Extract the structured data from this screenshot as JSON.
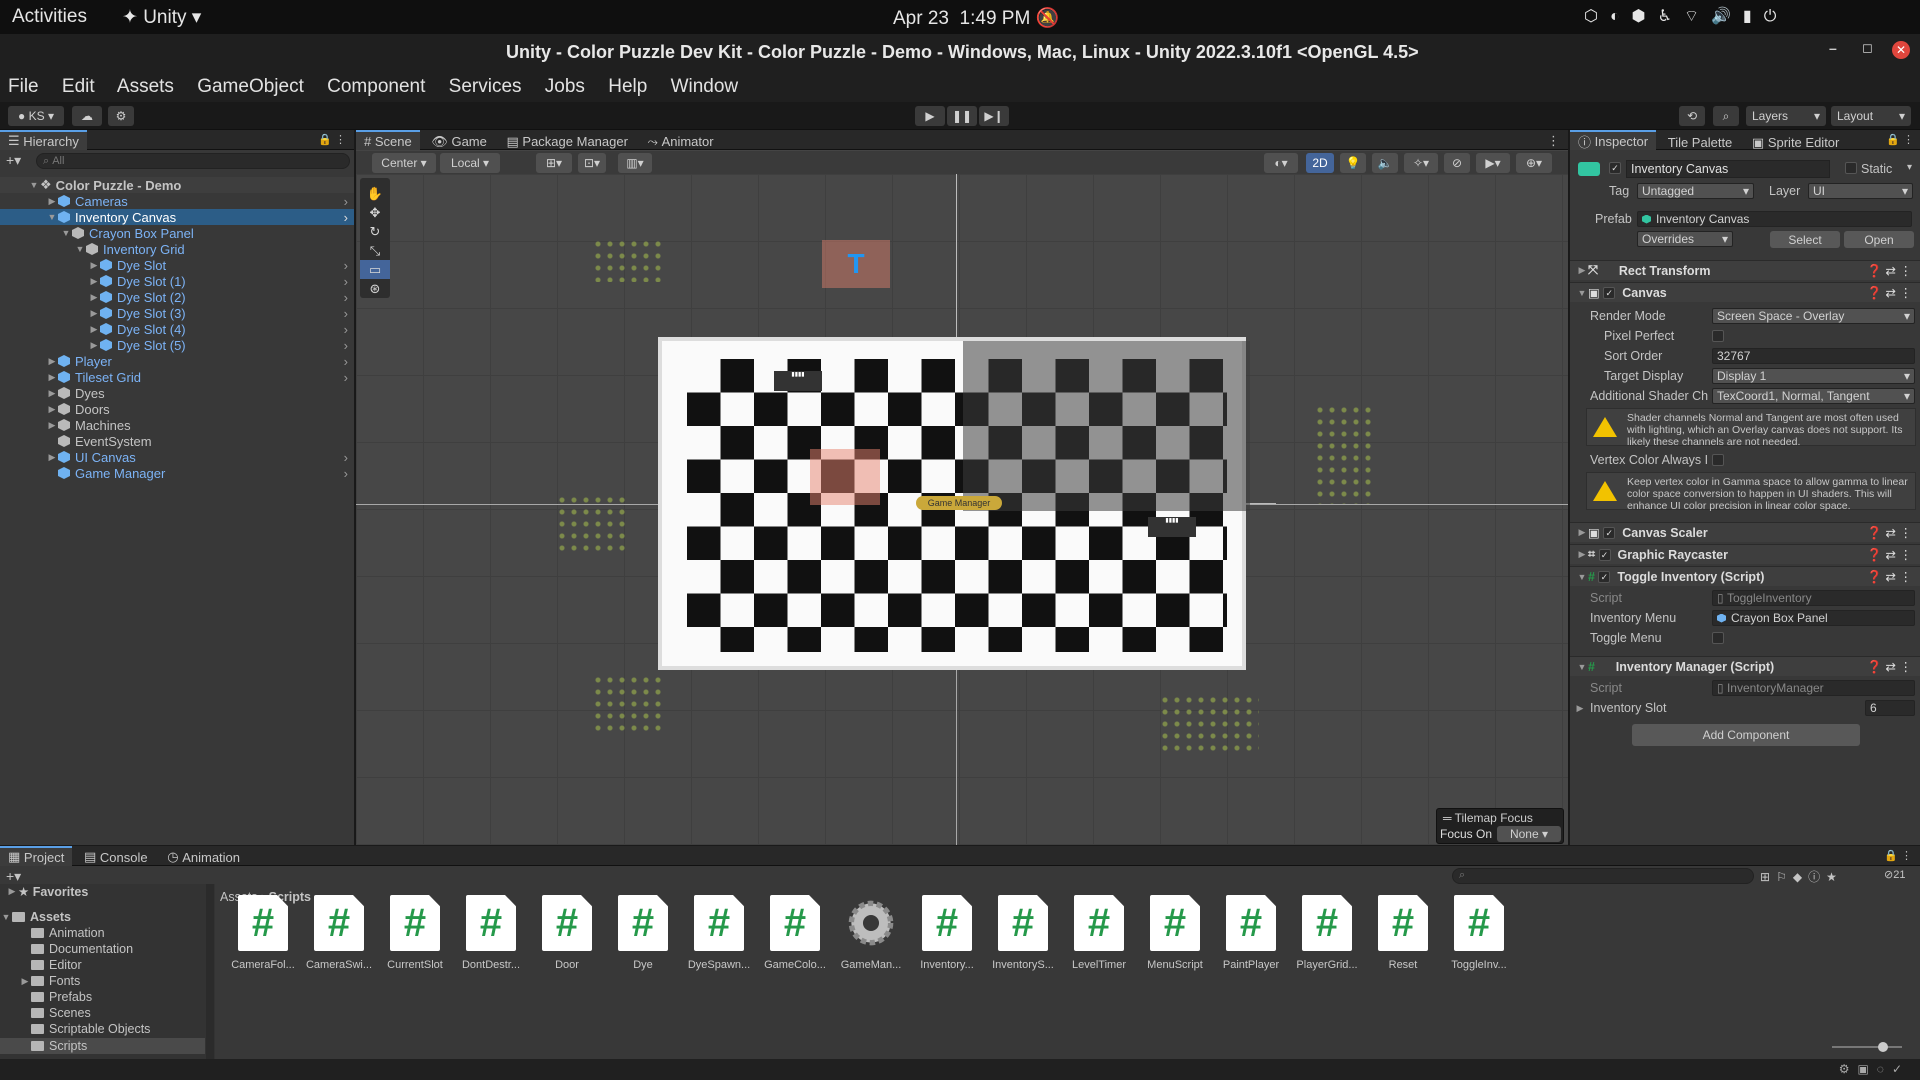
{
  "system": {
    "activities": "Activities",
    "app_menu": "Unity",
    "date": "Apr 23",
    "time": "1:49 PM"
  },
  "window": {
    "title": "Unity - Color Puzzle Dev Kit - Color Puzzle - Demo - Windows, Mac, Linux - Unity 2022.3.10f1 <OpenGL 4.5>"
  },
  "menu": [
    "File",
    "Edit",
    "Assets",
    "GameObject",
    "Component",
    "Services",
    "Jobs",
    "Help",
    "Window"
  ],
  "toolbar": {
    "account": "KS",
    "layers": "Layers",
    "layout": "Layout"
  },
  "hierarchy": {
    "tab": "Hierarchy",
    "search_placeholder": "All",
    "scene": "Color Puzzle - Demo",
    "items": [
      "Cameras",
      "Inventory Canvas",
      "Crayon Box Panel",
      "Inventory Grid",
      "Dye Slot",
      "Dye Slot (1)",
      "Dye Slot (2)",
      "Dye Slot (3)",
      "Dye Slot (4)",
      "Dye Slot (5)",
      "Player",
      "Tileset Grid",
      "Dyes",
      "Doors",
      "Machines",
      "EventSystem",
      "UI Canvas",
      "Game Manager"
    ]
  },
  "scene_tabs": [
    "Scene",
    "Game",
    "Package Manager",
    "Animator"
  ],
  "scene_toolbar": {
    "pivot": "Center",
    "space": "Local",
    "mode_2d": "2D"
  },
  "scene_overlay": {
    "game_manager_label": "Game Manager",
    "tilemap_focus": "Tilemap Focus",
    "focus_on_label": "Focus On",
    "focus_on_value": "None"
  },
  "inspector_tabs": [
    "Inspector",
    "Tile Palette",
    "Sprite Editor"
  ],
  "inspector": {
    "object_name": "Inventory Canvas",
    "static_label": "Static",
    "tag_label": "Tag",
    "tag_value": "Untagged",
    "layer_label": "Layer",
    "layer_value": "UI",
    "prefab_label": "Prefab",
    "prefab_value": "Inventory Canvas",
    "overrides": "Overrides",
    "select": "Select",
    "open": "Open",
    "components": {
      "rect_transform": "Rect Transform",
      "canvas": "Canvas",
      "canvas_scaler": "Canvas Scaler",
      "graphic_raycaster": "Graphic Raycaster",
      "toggle_inventory": "Toggle Inventory (Script)",
      "inventory_manager": "Inventory Manager (Script)"
    },
    "canvas": {
      "render_mode_label": "Render Mode",
      "render_mode": "Screen Space - Overlay",
      "pixel_perfect_label": "Pixel Perfect",
      "sort_order_label": "Sort Order",
      "sort_order": "32767",
      "target_display_label": "Target Display",
      "target_display": "Display 1",
      "shader_label": "Additional Shader Ch",
      "shader_value": "TexCoord1, Normal, Tangent",
      "warning1": "Shader channels Normal and Tangent are most often used with lighting, which an Overlay canvas does not support. Its likely these channels are not needed.",
      "vertex_label": "Vertex Color Always I",
      "warning2": "Keep vertex color in Gamma space to allow gamma to linear color space conversion to happen in UI shaders. This will enhance UI color precision in linear color space."
    },
    "toggle_inventory": {
      "script_label": "Script",
      "script_value": "ToggleInventory",
      "menu_label": "Inventory Menu",
      "menu_value": "Crayon Box Panel",
      "toggle_label": "Toggle Menu"
    },
    "inventory_manager": {
      "script_label": "Script",
      "script_value": "InventoryManager",
      "slot_label": "Inventory Slot",
      "slot_value": "6"
    },
    "add_component": "Add Component"
  },
  "project": {
    "tabs": [
      "Project",
      "Console",
      "Animation"
    ],
    "favorites": "Favorites",
    "assets": "Assets",
    "folders": [
      "Animation",
      "Documentation",
      "Editor",
      "Fonts",
      "Prefabs",
      "Scenes",
      "Scriptable Objects",
      "Scripts"
    ],
    "breadcrumb_root": "Assets",
    "breadcrumb_leaf": "Scripts",
    "hidden_count": "21",
    "files": [
      "CameraFol...",
      "CameraSwi...",
      "CurrentSlot",
      "DontDestr...",
      "Door",
      "Dye",
      "DyeSpawn...",
      "GameColo...",
      "GameMan...",
      "Inventory...",
      "InventoryS...",
      "LevelTimer",
      "MenuScript",
      "PaintPlayer",
      "PlayerGrid...",
      "Reset",
      "ToggleInv..."
    ]
  },
  "colors": {
    "accent": "#2c5d87",
    "script_hash": "#25994a",
    "warning": "#f2c200"
  }
}
